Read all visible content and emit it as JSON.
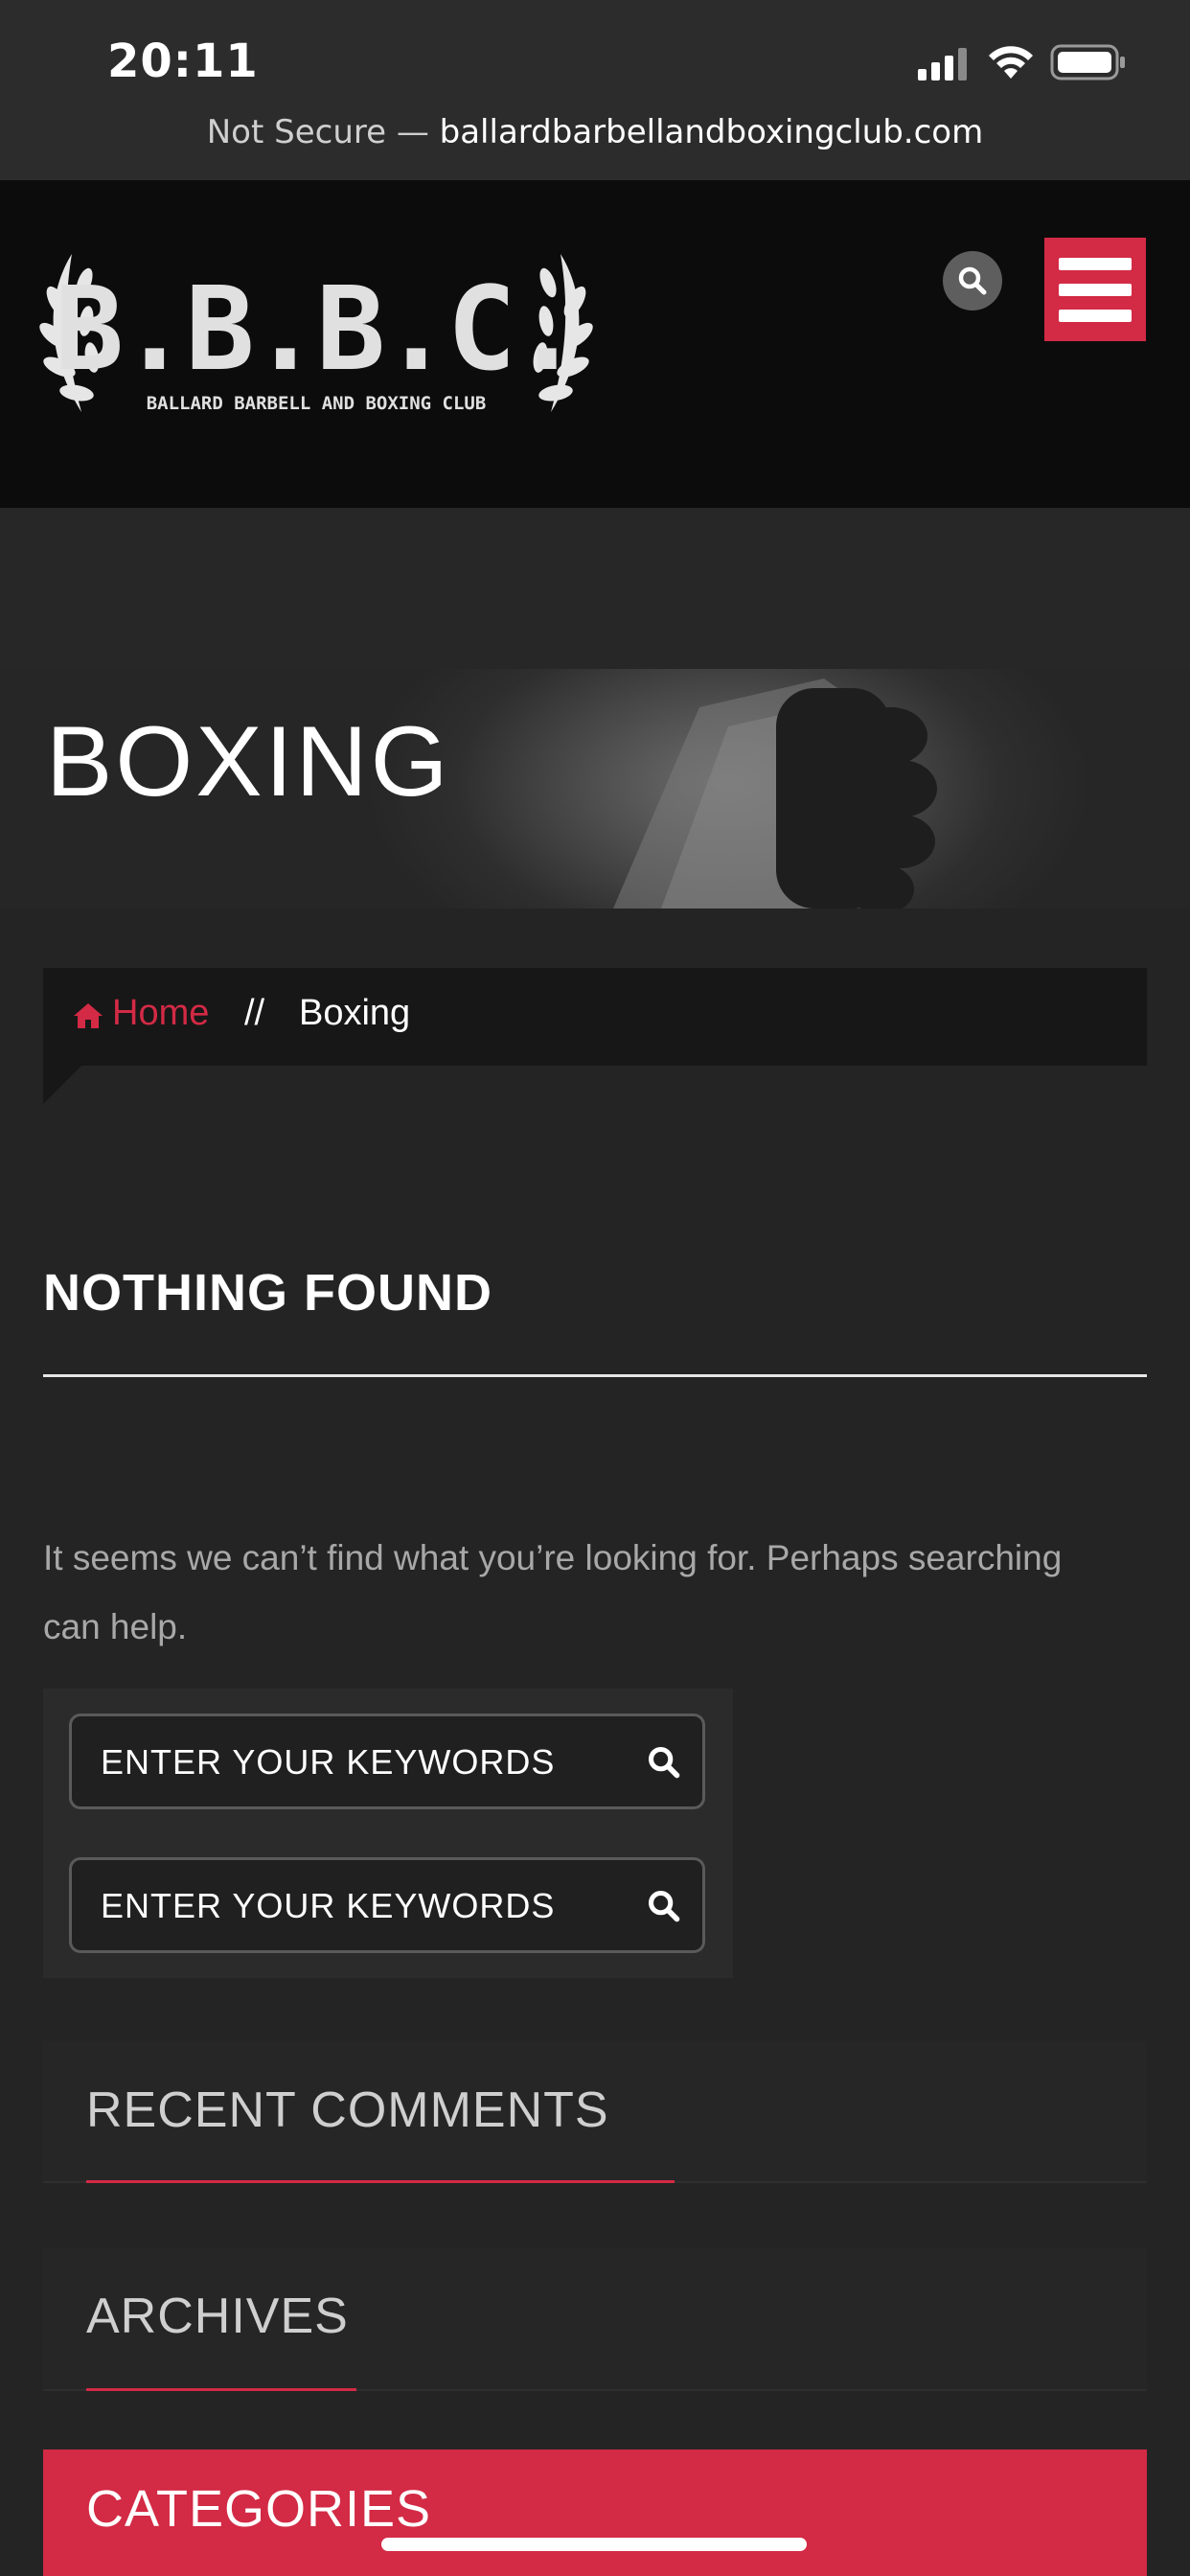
{
  "status_bar": {
    "time": "20:11"
  },
  "browser": {
    "url_prefix": "Not Secure — ",
    "url_domain": "ballardbarbellandboxingclub.com"
  },
  "header": {
    "logo_text": "B.B.B.C.",
    "logo_subtitle": "BALLARD BARBELL AND BOXING CLUB",
    "search_icon": "search-icon",
    "menu_icon": "hamburger-menu-icon"
  },
  "hero": {
    "title": "BOXING"
  },
  "breadcrumb": {
    "home_icon": "home-icon",
    "home": "Home",
    "separator": "//",
    "current": "Boxing"
  },
  "content": {
    "heading": "NOTHING FOUND",
    "message": "It seems we can’t find what you’re looking for. Perhaps searching can help."
  },
  "search_widget": {
    "fields": [
      {
        "placeholder": "ENTER YOUR KEYWORDS",
        "icon": "search-icon"
      },
      {
        "placeholder": "ENTER YOUR KEYWORDS",
        "icon": "search-icon"
      }
    ]
  },
  "sidebar": {
    "recent_comments": "RECENT COMMENTS",
    "archives": "ARCHIVES",
    "categories": "CATEGORIES"
  },
  "colors": {
    "accent": "#d32a45",
    "background": "#242424",
    "header": "#0c0c0c"
  }
}
